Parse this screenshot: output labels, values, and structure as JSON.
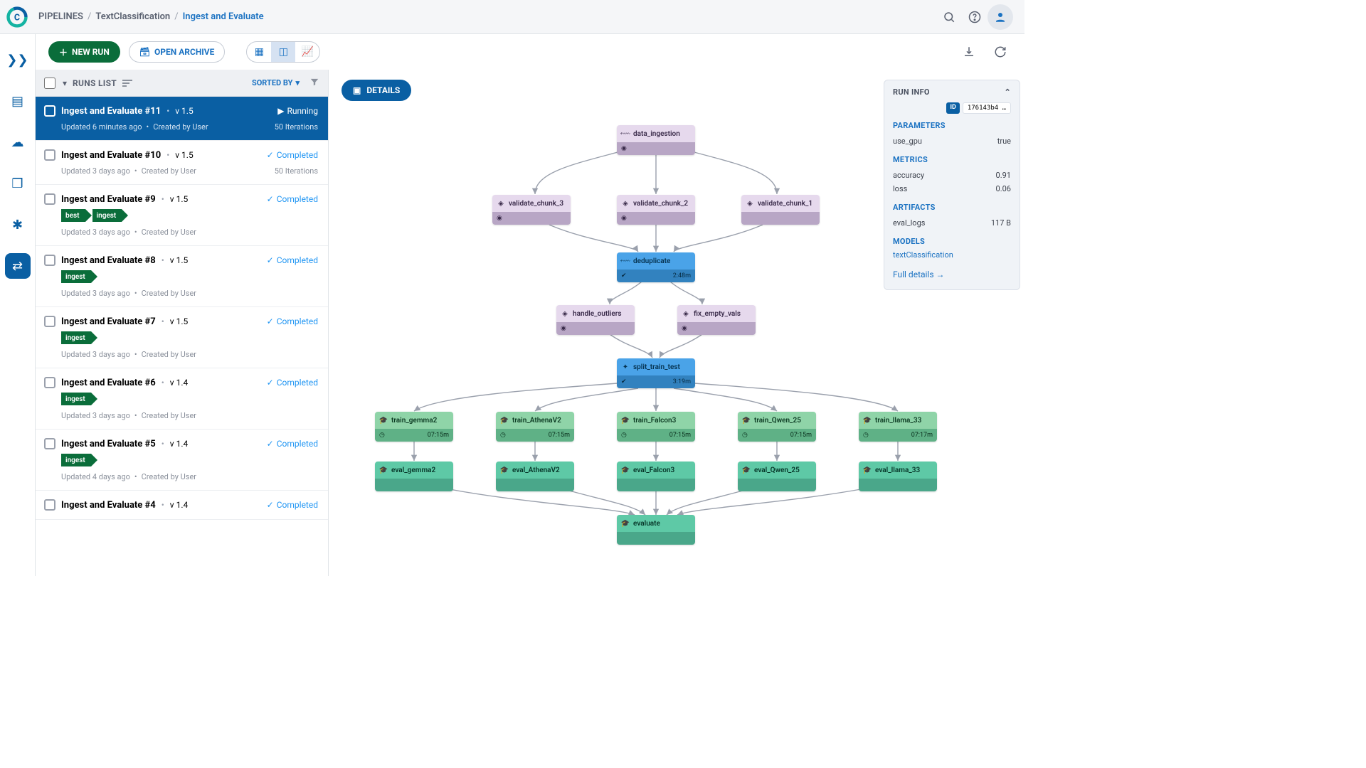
{
  "breadcrumbs": {
    "root": "PIPELINES",
    "project": "TextClassification",
    "leaf": "Ingest and Evaluate"
  },
  "toolbar": {
    "new_run": "NEW RUN",
    "open_archive": "OPEN ARCHIVE"
  },
  "runs_header": {
    "title": "RUNS LIST",
    "sorted_by": "SORTED BY"
  },
  "details_label": "DETAILS",
  "runs": [
    {
      "title": "Ingest and Evaluate #11",
      "ver": "v 1.5",
      "status": "Running",
      "status_kind": "running",
      "updated": "Updated 6 minutes ago",
      "by": "Created by User",
      "iter": "50 Iterations",
      "tags": [],
      "selected": true
    },
    {
      "title": "Ingest and Evaluate #10",
      "ver": "v 1.5",
      "status": "Completed",
      "status_kind": "completed",
      "updated": "Updated 3 days ago",
      "by": "Created by User",
      "iter": "50 Iterations",
      "tags": []
    },
    {
      "title": "Ingest and Evaluate #9",
      "ver": "v 1.5",
      "status": "Completed",
      "status_kind": "completed",
      "updated": "Updated 3 days ago",
      "by": "Created by User",
      "iter": "",
      "tags": [
        "best",
        "ingest"
      ]
    },
    {
      "title": "Ingest and Evaluate #8",
      "ver": "v 1.5",
      "status": "Completed",
      "status_kind": "completed",
      "updated": "Updated 3 days ago",
      "by": "Created by User",
      "iter": "",
      "tags": [
        "ingest"
      ]
    },
    {
      "title": "Ingest and Evaluate #7",
      "ver": "v 1.5",
      "status": "Completed",
      "status_kind": "completed",
      "updated": "Updated 3 days ago",
      "by": "Created by User",
      "iter": "",
      "tags": [
        "ingest"
      ]
    },
    {
      "title": "Ingest and Evaluate #6",
      "ver": "v 1.4",
      "status": "Completed",
      "status_kind": "completed",
      "updated": "Updated 3 days ago",
      "by": "Created by User",
      "iter": "",
      "tags": [
        "ingest"
      ]
    },
    {
      "title": "Ingest and Evaluate #5",
      "ver": "v 1.4",
      "status": "Completed",
      "status_kind": "completed",
      "updated": "Updated 4 days ago",
      "by": "Created by User",
      "iter": "",
      "tags": [
        "ingest"
      ]
    },
    {
      "title": "Ingest and Evaluate #4",
      "ver": "v 1.4",
      "status": "Completed",
      "status_kind": "completed",
      "updated": "",
      "by": "",
      "iter": "",
      "tags": []
    }
  ],
  "nodes": {
    "data_ingestion": "data_ingestion",
    "validate_chunk_3": "validate_chunk_3",
    "validate_chunk_2": "validate_chunk_2",
    "validate_chunk_1": "validate_chunk_1",
    "deduplicate": "deduplicate",
    "deduplicate_time": "2:48m",
    "handle_outliers": "handle_outliers",
    "fix_empty_vals": "fix_empty_vals",
    "split_train_test": "split_train_test",
    "split_time": "3:19m",
    "train_gemma2": "train_gemma2",
    "train_AthenaV2": "train_AthenaV2",
    "train_Falcon3": "train_Falcon3",
    "train_Qwen_25": "train_Qwen_25",
    "train_llama_33": "train_llama_33",
    "t_gemma2_time": "07:15m",
    "t_athena_time": "07:15m",
    "t_falcon_time": "07:15m",
    "t_qwen_time": "07:15m",
    "t_llama_time": "07:17m",
    "eval_gemma2": "eval_gemma2",
    "eval_AthenaV2": "eval_AthenaV2",
    "eval_Falcon3": "eval_Falcon3",
    "eval_Qwen_25": "eval_Qwen_25",
    "eval_llama_33": "eval_llama_33",
    "evaluate": "evaluate"
  },
  "info": {
    "header": "RUN INFO",
    "id_label": "ID",
    "id_value": "176143b4 …",
    "parameters_label": "PARAMETERS",
    "param_key": "use_gpu",
    "param_val": "true",
    "metrics_label": "METRICS",
    "m1k": "accuracy",
    "m1v": "0.91",
    "m2k": "loss",
    "m2v": "0.06",
    "artifacts_label": "ARTIFACTS",
    "a1k": "eval_logs",
    "a1v": "117 B",
    "models_label": "MODELS",
    "model_link": "textClassification",
    "full_details": "Full details →"
  }
}
